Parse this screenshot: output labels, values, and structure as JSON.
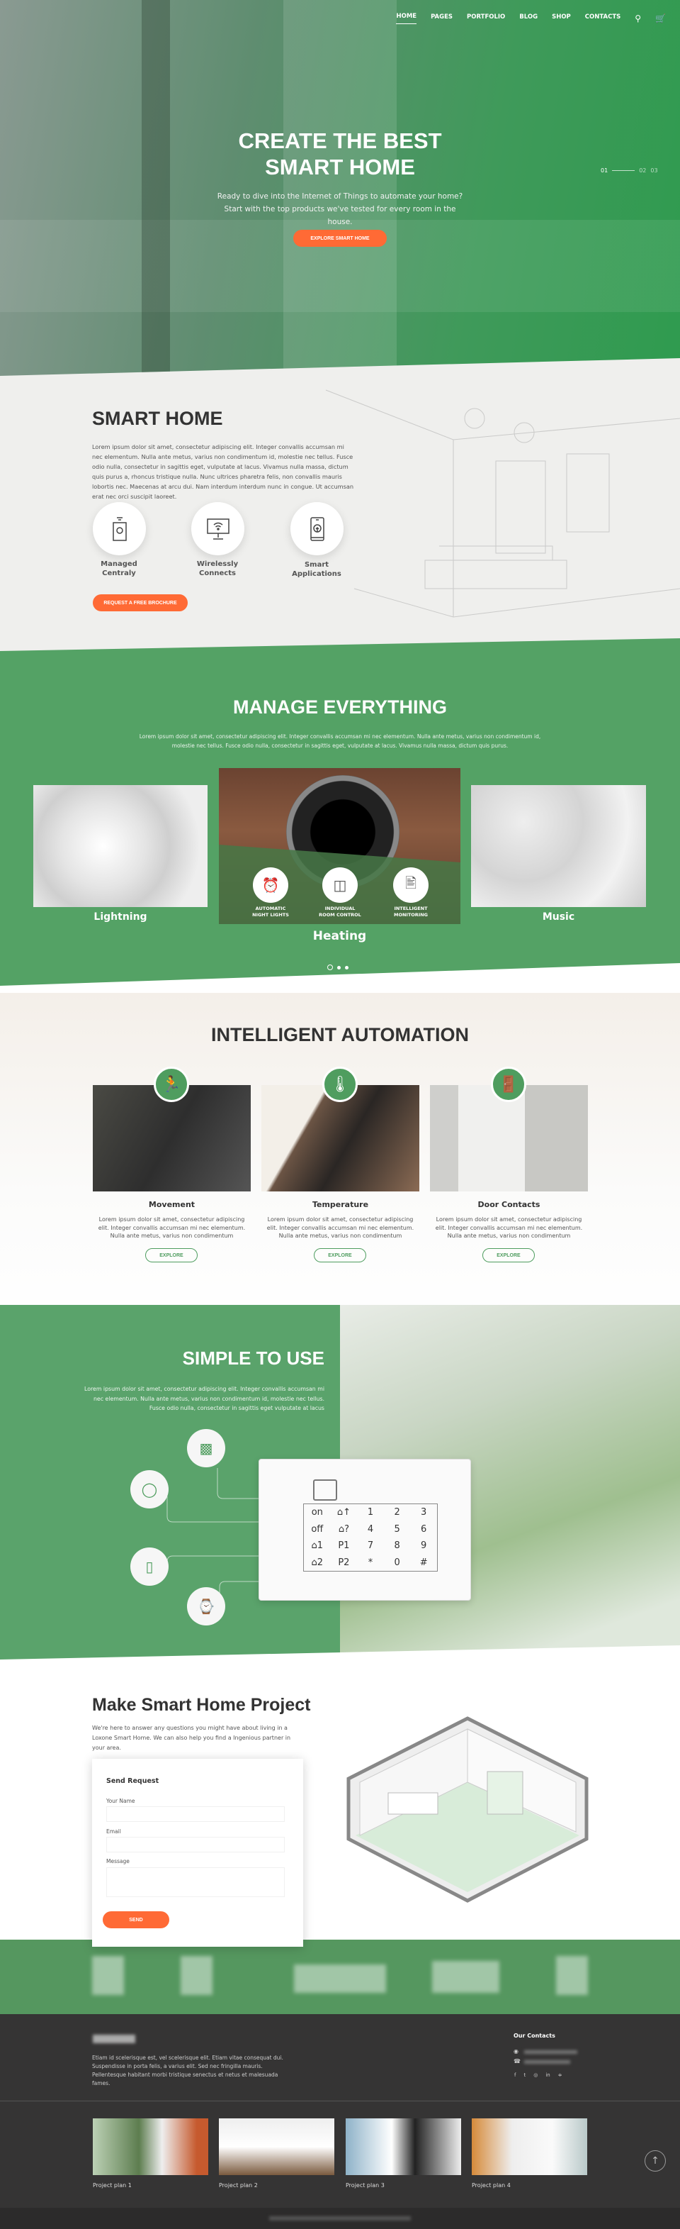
{
  "colors": {
    "accent_green": "#54a265",
    "accent_orange": "#ff6a35",
    "dark_text": "#333333",
    "footer_bg": "#353434"
  },
  "nav": {
    "items": [
      "HOME",
      "PAGES",
      "PORTFOLIO",
      "BLOG",
      "SHOP",
      "CONTACTS"
    ],
    "active": "HOME",
    "icons": [
      "search-icon",
      "cart-icon"
    ]
  },
  "hero": {
    "title_line1": "CREATE THE BEST",
    "title_line2": "SMART HOME",
    "subtitle_line1": "Ready to dive into the Internet of Things to automate your home?",
    "subtitle_line2": "Start with the top products we've tested for every room in the house.",
    "button": "EXPLORE SMART HOME",
    "slides": [
      "01",
      "02",
      "03"
    ],
    "active_slide": "01"
  },
  "smart_home": {
    "title": "SMART HOME",
    "text": "Lorem ipsum dolor sit amet, consectetur adipiscing elit. Integer convallis accumsan mi nec elementum. Nulla ante metus, varius non condimentum id, molestie nec tellus. Fusce odio nulla, consectetur in sagittis eget, vulputate at lacus. Vivamus nulla massa, dictum quis purus a, rhoncus tristique nulla. Nunc ultrices pharetra felis, non convallis mauris lobortis nec. Maecenas at arcu dui. Nam interdum interdum nunc in congue. Ut accumsan erat nec orci suscipit laoreet.",
    "features": [
      {
        "line1": "Managed",
        "line2": "Centraly",
        "icon": "remote-device-icon"
      },
      {
        "line1": "Wirelessly",
        "line2": "Connects",
        "icon": "monitor-wifi-icon"
      },
      {
        "line1": "Smart",
        "line2": "Applications",
        "icon": "smartphone-app-icon"
      }
    ],
    "button": "REQUEST A FREE BROCHURE"
  },
  "manage": {
    "title": "MANAGE EVERYTHING",
    "text_line1": "Lorem ipsum dolor sit amet, consectetur adipiscing elit. Integer convallis accumsan mi nec elementum. Nulla ante metus, varius non condimentum id,",
    "text_line2": "molestie nec tellus. Fusce odio nulla, consectetur in sagittis eget, vulputate at lacus. Vivamus nulla massa, dictum quis purus.",
    "cards": [
      "Lightning",
      "Heating",
      "Music"
    ],
    "active_card": "Heating",
    "heating_features": [
      {
        "line1": "AUTOMATIC",
        "line2": "NIGHT LIGHTS",
        "icon": "alarm-clock-icon"
      },
      {
        "line1": "INDIVIDUAL",
        "line2": "ROOM CONTROL",
        "icon": "switch-icon"
      },
      {
        "line1": "INTELLIGENT",
        "line2": "MONITORING",
        "icon": "monitor-speaker-icon"
      }
    ],
    "carousel_dots": 3,
    "active_dot": 1
  },
  "automation": {
    "title": "INTELLIGENT AUTOMATION",
    "cards": [
      {
        "title": "Movement",
        "icon": "running-person-icon",
        "text": "Lorem ipsum dolor sit amet, consectetur adipiscing elit. Integer convallis accumsan mi nec elementum. Nulla ante metus, varius non condimentum",
        "button": "EXPLORE"
      },
      {
        "title": "Temperature",
        "icon": "thermometer-icon",
        "text": "Lorem ipsum dolor sit amet, consectetur adipiscing elit. Integer convallis accumsan mi nec elementum. Nulla ante metus, varius non condimentum",
        "button": "EXPLORE"
      },
      {
        "title": "Door Contacts",
        "icon": "door-icon",
        "text": "Lorem ipsum dolor sit amet, consectetur adipiscing elit. Integer convallis accumsan mi nec elementum. Nulla ante metus, varius non condimentum",
        "button": "EXPLORE"
      }
    ]
  },
  "simple": {
    "title": "SIMPLE TO USE",
    "text": "Lorem ipsum dolor sit amet, consectetur adipiscing elit. Integer convallis accumsan mi nec elementum. Nulla ante metus, varius non condimentum id, molestie nec tellus. Fusce odio nulla, consectetur in sagittis eget vulputate at lacus",
    "devices": [
      "remote-icon",
      "mouse-icon",
      "phone-icon",
      "smartwatch-icon"
    ],
    "keypad": [
      "on",
      "⌂↑",
      "1",
      "2",
      "3",
      "off",
      "⌂?",
      "4",
      "5",
      "6",
      "⌂1",
      "P1",
      "7",
      "8",
      "9",
      "⌂2",
      "P2",
      "*",
      "0",
      "#"
    ]
  },
  "project": {
    "title": "Make Smart Home Project",
    "text": "We're here to answer any questions you might have about living in a Loxone Smart Home. We can also help you find a Ingenious partner in your area.",
    "form": {
      "title": "Send Request",
      "name_label": "Your Name",
      "email_label": "Email",
      "message_label": "Message",
      "button": "SEND"
    }
  },
  "footer": {
    "about": "Etiam id scelerisque est, vel scelerisque elit. Etiam vitae consequat dui. Suspendisse in porta felis, a varius elit. Sed nec fringilla mauris. Pellentesque habitant morbi tristique senectus et netus et malesuada fames.",
    "contacts_title": "Our Contacts",
    "social": [
      "facebook-icon",
      "twitter-icon",
      "instagram-icon",
      "linkedin-icon",
      "rss-icon"
    ],
    "projects": [
      "Project plan 1",
      "Project plan 2",
      "Project plan 3",
      "Project plan 4"
    ]
  }
}
